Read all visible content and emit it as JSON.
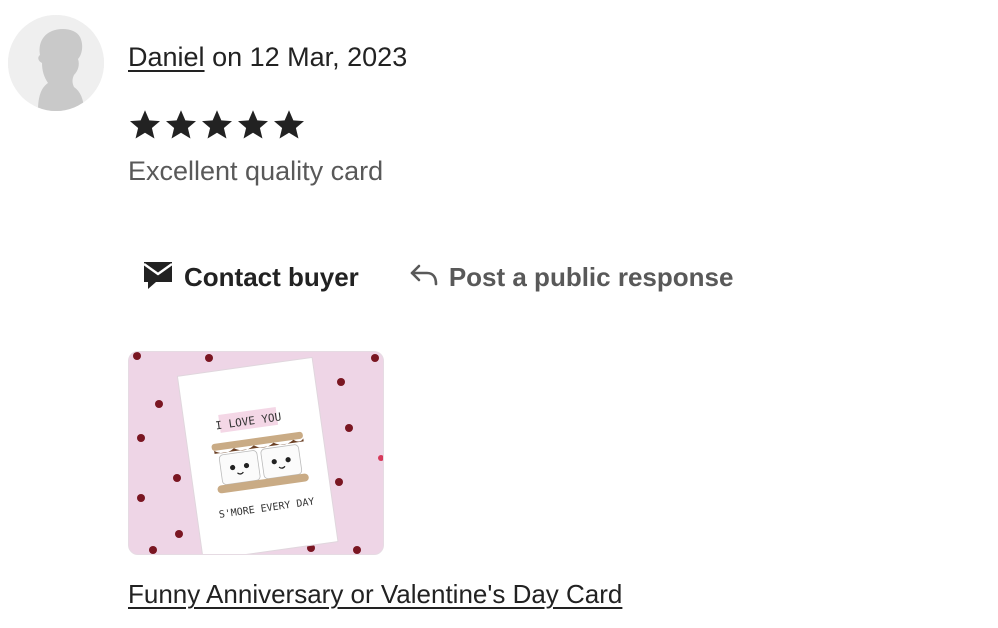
{
  "review": {
    "reviewer_name": "Daniel",
    "date_text": "on 12 Mar, 2023",
    "rating": 5,
    "rating_max": 5,
    "text": "Excellent quality card"
  },
  "actions": {
    "contact_label": "Contact buyer",
    "respond_label": "Post a public response"
  },
  "listing": {
    "title": "Funny Anniversary or Valentine's Day Card",
    "card_line_top": "I LOVE YOU",
    "card_line_bottom": "S'MORE EVERY DAY"
  },
  "colors": {
    "star": "#222222",
    "thumbnail_background": "#eed5e6",
    "heart": "#7a1622"
  },
  "icons": {
    "avatar": "default-user-silhouette",
    "contact": "envelope-chat-icon",
    "respond": "reply-arrow-icon",
    "star": "filled-star-icon"
  }
}
